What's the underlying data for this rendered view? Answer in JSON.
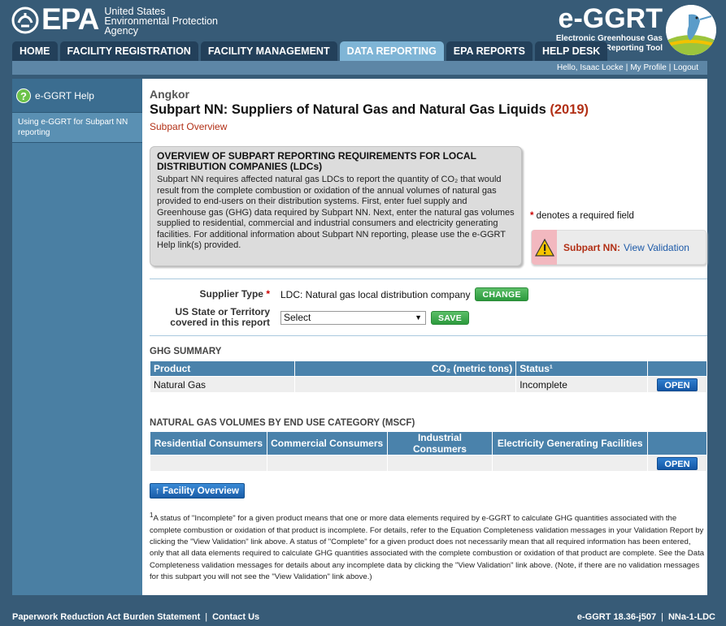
{
  "header": {
    "epa_word": "EPA",
    "agency_line1": "United States",
    "agency_line2": "Environmental Protection",
    "agency_line3": "Agency",
    "app_name": "e-GGRT",
    "app_sub1": "Electronic Greenhouse Gas",
    "app_sub2": "Reporting Tool"
  },
  "nav": {
    "tabs": [
      {
        "label": "HOME"
      },
      {
        "label": "FACILITY REGISTRATION"
      },
      {
        "label": "FACILITY MANAGEMENT"
      },
      {
        "label": "DATA REPORTING"
      },
      {
        "label": "EPA REPORTS"
      },
      {
        "label": "HELP DESK"
      }
    ]
  },
  "userbar": {
    "greeting": "Hello, Isaac Locke",
    "profile": "My Profile",
    "logout": "Logout"
  },
  "sidebar": {
    "help_title": "e-GGRT Help",
    "help_link": "Using e-GGRT for Subpart NN reporting"
  },
  "main": {
    "facility_name": "Angkor",
    "subpart_title": "Subpart NN: Suppliers of Natural Gas and Natural Gas Liquids",
    "subpart_year": "(2019)",
    "subpart_overview": "Subpart Overview",
    "overview_heading": "OVERVIEW OF SUBPART REPORTING REQUIREMENTS FOR LOCAL DISTRIBUTION COMPANIES (LDCs)",
    "overview_text": "Subpart NN requires affected natural gas LDCs to report the quantity of CO₂ that would result from the complete combustion or oxidation of the annual volumes of natural gas provided to end-users on their distribution systems. First, enter fuel supply and Greenhouse gas (GHG) data required by Subpart NN. Next, enter the natural gas volumes supplied to residential, commercial and industrial consumers and electricity generating facilities. For additional information about Subpart NN reporting, please use the e-GGRT Help link(s) provided.",
    "required_star": "*",
    "required_text": " denotes a required field",
    "validation_label": "Subpart NN:",
    "validation_link": "View Validation"
  },
  "form": {
    "supplier_type_label": "Supplier Type",
    "supplier_type_value": "LDC: Natural gas local distribution company",
    "change_button": "CHANGE",
    "state_label": "US State or Territory covered in this report",
    "state_selected": "Select",
    "save_button": "SAVE"
  },
  "ghg_summary": {
    "heading": "GHG SUMMARY",
    "columns": [
      "Product",
      "CO₂ (metric tons)",
      "Status¹"
    ],
    "rows": [
      {
        "product": "Natural Gas",
        "co2": "",
        "status": "Incomplete",
        "action": "OPEN"
      }
    ]
  },
  "volumes": {
    "heading": "NATURAL GAS VOLUMES BY END USE CATEGORY (MSCF)",
    "columns": [
      "Residential Consumers",
      "Commercial Consumers",
      "Industrial Consumers",
      "Electricity Generating Facilities"
    ],
    "action": "OPEN"
  },
  "facility_overview_button": "Facility Overview",
  "footnote": {
    "mark": "1",
    "text": "A status of \"Incomplete\" for a given product means that one or more data elements required by e-GGRT to calculate GHG quantities associated with the complete combustion or oxidation of that product is incomplete. For details, refer to the Equation Completeness validation messages in your Validation Report by clicking the \"View Validation\" link above. A status of \"Complete\" for a given product does not necessarily mean that all required information has been entered, only that all data elements required to calculate GHG quantities associated with the complete combustion or oxidation of that product are complete. See the Data Completeness validation messages for details about any incomplete data by clicking the \"View Validation\" link above. (Note, if there are no validation messages for this subpart you will not see the \"View Validation\" link above.)"
  },
  "footer": {
    "paperwork": "Paperwork Reduction Act Burden Statement",
    "contact": "Contact Us",
    "version": "e-GGRT 18.36-j507",
    "screen_id": "NNa-1-LDC"
  }
}
